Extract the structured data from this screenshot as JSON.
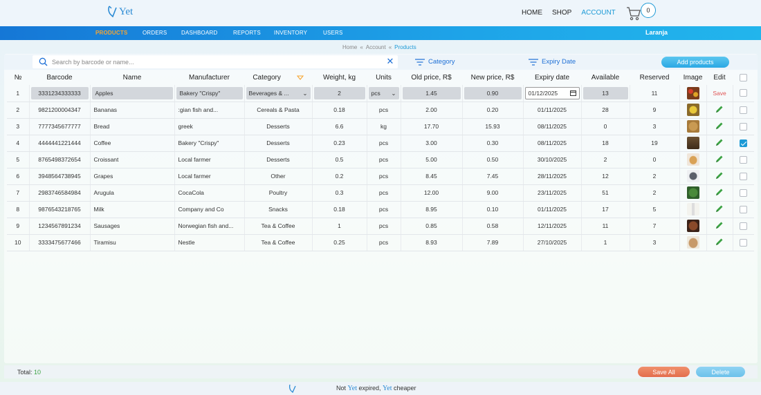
{
  "brand": {
    "name": "Yet"
  },
  "topnav": {
    "home": "HOME",
    "shop": "SHOP",
    "account": "ACCOUNT",
    "cart_count": "0"
  },
  "bluenav": {
    "items": [
      "PRODUCTS",
      "ORDERS",
      "DASHBOARD",
      "REPORTS",
      "INVENTORY",
      "USERS"
    ],
    "user": "Laranja"
  },
  "breadcrumb": {
    "home": "Home",
    "account": "Account",
    "current": "Products"
  },
  "toolbar": {
    "search_placeholder": "Search by barcode or name...",
    "search_value": "",
    "filter_category": "Category",
    "filter_expiry": "Expiry Date",
    "add_label": "Add products"
  },
  "table": {
    "headers": [
      "№",
      "Barcode",
      "Name",
      "Manufacturer",
      "Category",
      "Weight, kg",
      "Units",
      "Old price, R$",
      "New price, R$",
      "Expiry date",
      "Available",
      "Reserved",
      "Image",
      "Edit"
    ],
    "edit_row": {
      "num": "1",
      "barcode": "3331234333333",
      "name": "Apples",
      "manufacturer": "Bakery \"Crispy\"",
      "category": "Beverages & ...",
      "weight": "2",
      "units": "pcs",
      "old_price": "1.45",
      "new_price": "0.90",
      "expiry": "01/12/2025",
      "available": "13",
      "reserved": "11",
      "save_label": "Save",
      "image": "apples-photo"
    },
    "rows": [
      {
        "num": "2",
        "barcode": "9821200004347",
        "name": "Bananas",
        "manufacturer": ":gian fish and...",
        "category": "Cereals & Pasta",
        "weight": "0.18",
        "units": "pcs",
        "old_price": "2.00",
        "new_price": "0.20",
        "expiry": "01/11/2025",
        "available": "28",
        "reserved": "9",
        "image": "bananas-photo",
        "checked": false
      },
      {
        "num": "3",
        "barcode": "7777345677777",
        "name": "Bread",
        "manufacturer": "greek",
        "category": "Desserts",
        "weight": "6.6",
        "units": "kg",
        "old_price": "17.70",
        "new_price": "15.93",
        "expiry": "08/11/2025",
        "available": "0",
        "reserved": "3",
        "image": "bread-photo",
        "checked": false
      },
      {
        "num": "4",
        "barcode": "4444441221444",
        "name": "Coffee",
        "manufacturer": "Bakery \"Crispy\"",
        "category": "Desserts",
        "weight": "0.23",
        "units": "pcs",
        "old_price": "3.00",
        "new_price": "0.30",
        "expiry": "08/11/2025",
        "available": "18",
        "reserved": "19",
        "image": "coffee-photo",
        "checked": true
      },
      {
        "num": "5",
        "barcode": "8765498372654",
        "name": "Croissant",
        "manufacturer": "Local farmer",
        "category": "Desserts",
        "weight": "0.5",
        "units": "pcs",
        "old_price": "5.00",
        "new_price": "0.50",
        "expiry": "30/10/2025",
        "available": "2",
        "reserved": "0",
        "image": "croissant-photo",
        "checked": false
      },
      {
        "num": "6",
        "barcode": "3948564738945",
        "name": "Grapes",
        "manufacturer": "Local farmer",
        "category": "Other",
        "weight": "0.2",
        "units": "pcs",
        "old_price": "8.45",
        "new_price": "7.45",
        "expiry": "28/11/2025",
        "available": "12",
        "reserved": "2",
        "image": "grapes-photo",
        "checked": false
      },
      {
        "num": "7",
        "barcode": "2983746584984",
        "name": "Arugula",
        "manufacturer": "CocaCola",
        "category": "Poultry",
        "weight": "0.3",
        "units": "pcs",
        "old_price": "12.00",
        "new_price": "9.00",
        "expiry": "23/11/2025",
        "available": "51",
        "reserved": "2",
        "image": "arugula-photo",
        "checked": false
      },
      {
        "num": "8",
        "barcode": "9876543218765",
        "name": "Milk",
        "manufacturer": "Company and Co",
        "category": "Snacks",
        "weight": "0.18",
        "units": "pcs",
        "old_price": "8.95",
        "new_price": "0.10",
        "expiry": "01/11/2025",
        "available": "17",
        "reserved": "5",
        "image": "milk-photo",
        "checked": false
      },
      {
        "num": "9",
        "barcode": "1234567891234",
        "name": "Sausages",
        "manufacturer": "Norwegian fish and...",
        "category": "Tea & Coffee",
        "weight": "1",
        "units": "pcs",
        "old_price": "0.85",
        "new_price": "0.58",
        "expiry": "12/11/2025",
        "available": "11",
        "reserved": "7",
        "image": "sausages-photo",
        "checked": false
      },
      {
        "num": "10",
        "barcode": "3333475677466",
        "name": "Tiramisu",
        "manufacturer": "Nestle",
        "category": "Tea & Coffee",
        "weight": "0.25",
        "units": "pcs",
        "old_price": "8.93",
        "new_price": "7.89",
        "expiry": "27/10/2025",
        "available": "1",
        "reserved": "3",
        "image": "tiramisu-photo",
        "checked": false
      }
    ]
  },
  "footer": {
    "total_label": "Total:",
    "total_value": "10",
    "save_all": "Save All",
    "delete": "Delete"
  },
  "slogan": {
    "not": "Not",
    "yet1": "Yet",
    "expired": "expired,",
    "yet2": "Yet",
    "cheaper": "cheaper"
  },
  "colors": {
    "accent": "#1d9ad6",
    "nav_blue": "#1577d6",
    "active_orange": "#f7a531",
    "save_red": "#e36d4c",
    "pencil_green": "#3ca243"
  }
}
